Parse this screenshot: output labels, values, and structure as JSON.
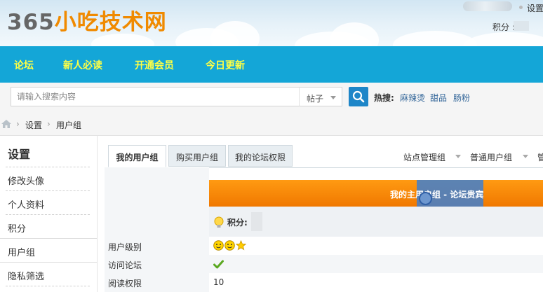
{
  "header": {
    "logo_number": "365",
    "logo_text": "小吃技术网",
    "settings_label": "设置",
    "points_label": "积分 :"
  },
  "nav": {
    "items": [
      {
        "label": "论坛"
      },
      {
        "label": "新人必读"
      },
      {
        "label": "开通会员"
      },
      {
        "label": "今日更新"
      }
    ]
  },
  "search": {
    "placeholder": "请输入搜索内容",
    "type_value": "帖子",
    "hot_label": "热搜:",
    "hot_terms": [
      "麻辣烫",
      "甜品",
      "肠粉"
    ]
  },
  "breadcrumb": {
    "items": [
      "设置",
      "用户组"
    ]
  },
  "sidebar": {
    "title": "设置",
    "items": [
      {
        "label": "修改头像"
      },
      {
        "label": "个人资料"
      },
      {
        "label": "积分"
      },
      {
        "label": "用户组"
      },
      {
        "label": "隐私筛选"
      }
    ]
  },
  "tabs": {
    "items": [
      {
        "label": "我的用户组"
      },
      {
        "label": "购买用户组"
      },
      {
        "label": "我的论坛权限"
      }
    ],
    "right_links": [
      "站点管理组",
      "普通用户组"
    ]
  },
  "usergroup": {
    "banner_text": "我的主用户组 - 论坛贵宾",
    "points_label": "积分:",
    "rows": [
      {
        "label": "用户级别",
        "value": ""
      },
      {
        "label": "访问论坛",
        "value": ""
      },
      {
        "label": "阅读权限",
        "value": "10"
      }
    ]
  },
  "colors": {
    "nav_bg": "#14a6d7",
    "nav_text": "#ffff45",
    "logo_orange": "#f08a00",
    "banner_orange": "#f58400",
    "search_button": "#1e86c8"
  }
}
